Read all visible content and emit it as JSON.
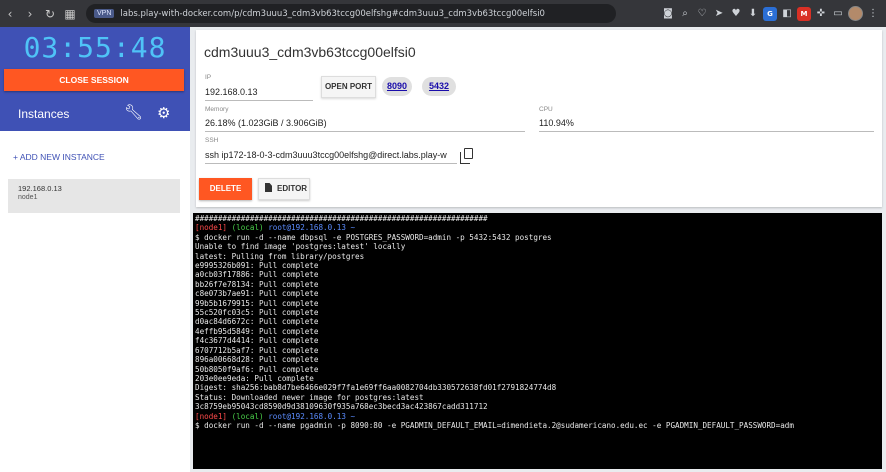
{
  "browser": {
    "url": "labs.play-with-docker.com/p/cdm3uuu3_cdm3vb63tccg00elfshg#cdm3uuu3_cdm3vb63tccg00elfsi0",
    "vpn_badge": "VPN",
    "ext_badge_1": "M"
  },
  "sidebar": {
    "timer": "03:55:48",
    "close_session": "CLOSE SESSION",
    "instances_title": "Instances",
    "add_new": "+ ADD NEW INSTANCE",
    "instance": {
      "ip": "192.168.0.13",
      "name": "node1"
    }
  },
  "panel": {
    "title": "cdm3uuu3_cdm3vb63tccg00elfsi0",
    "ip_label": "IP",
    "ip_value": "192.168.0.13",
    "open_port": "OPEN PORT",
    "ports": [
      "8090",
      "5432"
    ],
    "memory_label": "Memory",
    "memory_value": "26.18% (1.023GiB / 3.906GiB)",
    "cpu_label": "CPU",
    "cpu_value": "110.94%",
    "ssh_label": "SSH",
    "ssh_value": "ssh ip172-18-0-3-cdm3uuu3tccg00elfshg@direct.labs.play-w",
    "delete": "DELETE",
    "editor": "EDITOR"
  },
  "terminal": {
    "banner": "################################################################",
    "prompt_node": "[node1]",
    "prompt_local": "(local)",
    "prompt_user": "root@192.168.0.13",
    "prompt_tilde": "~",
    "cmd1": "$ docker run -d --name dbpsql -e POSTGRES_PASSWORD=admin -p 5432:5432 postgres",
    "output": [
      "Unable to find image 'postgres:latest' locally",
      "latest: Pulling from library/postgres",
      "e9995326b091: Pull complete",
      "a0cb03f17886: Pull complete",
      "bb26f7e78134: Pull complete",
      "c8e073b7ae91: Pull complete",
      "99b5b1679915: Pull complete",
      "55c520fc03c5: Pull complete",
      "d0ac84d6672c: Pull complete",
      "4effb95d5849: Pull complete",
      "f4c3677d4414: Pull complete",
      "6707712b5af7: Pull complete",
      "896a00668d28: Pull complete",
      "50b8050f9af6: Pull complete",
      "203e0ee9eda: Pull complete",
      "Digest: sha256:bab8d7be6466e029f7fa1e69ff6aa0082704db330572638fd01f2791824774d8",
      "Status: Downloaded newer image for postgres:latest",
      "3c8759eb95043cd8590d9d38109630f935a768ec3becd3ac423867cadd311712"
    ],
    "cmd2": "$ docker run -d --name pgadmin -p 8090:80 -e PGADMIN_DEFAULT_EMAIL=dimendieta.2@sudamericano.edu.ec -e PGADMIN_DEFAULT_PASSWORD=adm"
  }
}
